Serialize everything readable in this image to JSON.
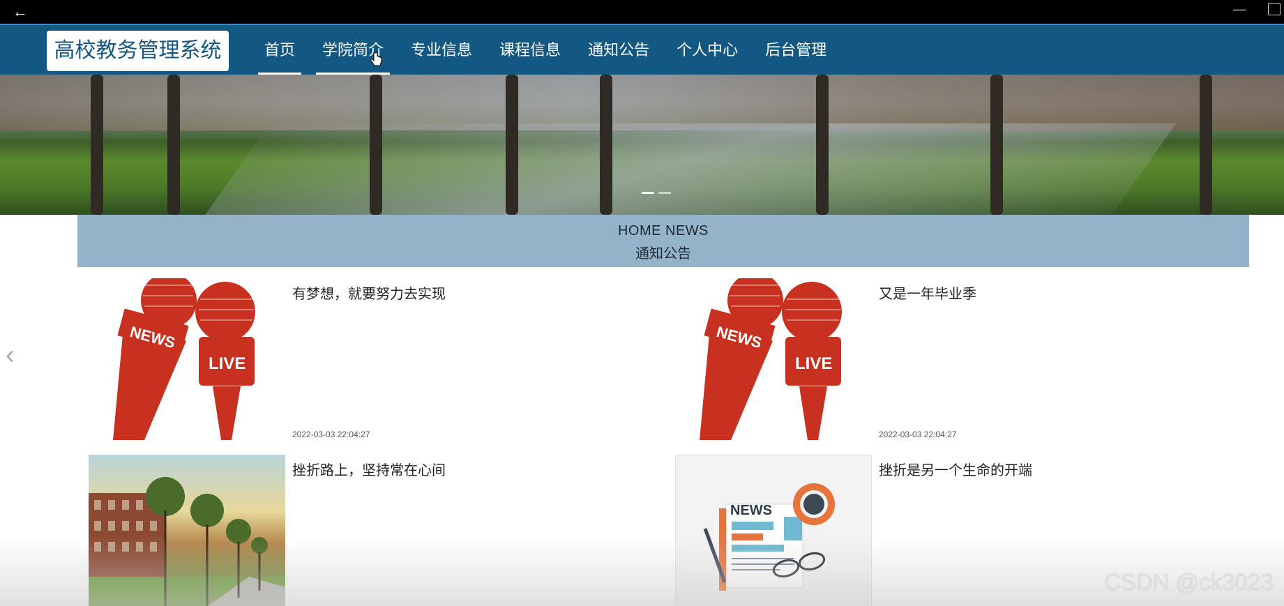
{
  "window": {
    "back_icon": "arrow-left-icon",
    "minimize_icon": "minimize-icon",
    "maximize_icon": "restore-icon"
  },
  "header": {
    "logo": "高校教务管理系统",
    "nav": [
      {
        "label": "首页",
        "state": "active"
      },
      {
        "label": "学院简介",
        "state": "hover"
      },
      {
        "label": "专业信息",
        "state": ""
      },
      {
        "label": "课程信息",
        "state": ""
      },
      {
        "label": "通知公告",
        "state": ""
      },
      {
        "label": "个人中心",
        "state": ""
      },
      {
        "label": "后台管理",
        "state": ""
      }
    ]
  },
  "news": {
    "heading_en": "HOME NEWS",
    "heading_cn": "通知公告",
    "items": [
      {
        "title": "有梦想，就要努力去实现",
        "date": "2022-03-03 22:04:27",
        "thumb": "news-live-microphone"
      },
      {
        "title": "又是一年毕业季",
        "date": "2022-03-03 22:04:27",
        "thumb": "news-live-microphone"
      },
      {
        "title": "挫折路上，坚持常在心间",
        "date": "",
        "thumb": "campus-building-photo"
      },
      {
        "title": "挫折是另一个生命的开端",
        "date": "",
        "thumb": "newspaper-glasses"
      }
    ]
  },
  "watermark": "CSDN @ck3023",
  "colors": {
    "header_bg": "#135783",
    "news_head_bg": "#95b3c8",
    "mic_red": "#c8311f"
  }
}
